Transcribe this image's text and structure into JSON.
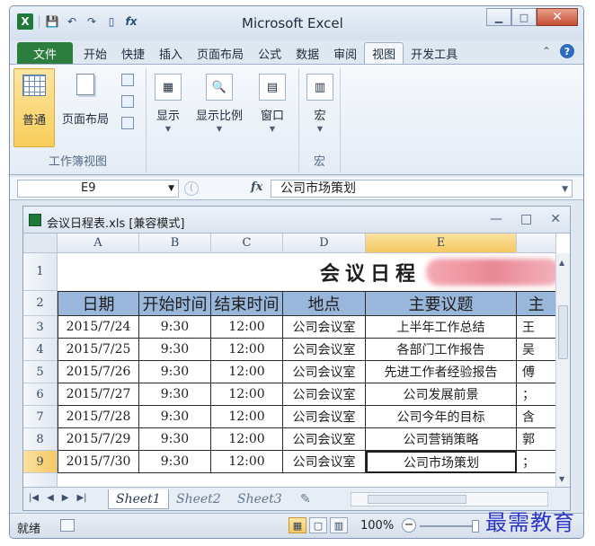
{
  "window": {
    "title": "Microsoft Excel",
    "minimize": "▁",
    "maximize": "□",
    "close": "✕"
  },
  "qat": {
    "logo": "X",
    "save": "💾",
    "undo": "↶",
    "redo": "↷",
    "new": "▯",
    "fx": "fx"
  },
  "tabs": {
    "file": "文件",
    "items": [
      "开始",
      "快捷",
      "插入",
      "页面布局",
      "公式",
      "数据",
      "审阅",
      "视图",
      "开发工具"
    ],
    "active_index": 7,
    "collapse": "⌃",
    "help": "?"
  },
  "ribbon": {
    "normal": "普通",
    "page_layout": "页面布局",
    "group_views": "工作簿视图",
    "show": "显示",
    "zoom": "显示比例",
    "window": "窗口",
    "macro": "宏",
    "group_macro": "宏"
  },
  "formula_bar": {
    "name_box": "E9",
    "fx": "fx",
    "content": "公司市场策划"
  },
  "workbook": {
    "name": "会议日程表.xls  [兼容模式]",
    "minimize": "—",
    "restore": "□",
    "close": "✕"
  },
  "sheet": {
    "columns": [
      "A",
      "B",
      "C",
      "D",
      "E"
    ],
    "selected_column": "E",
    "rows": [
      "1",
      "2",
      "3",
      "4",
      "5",
      "6",
      "7",
      "8",
      "9"
    ],
    "selected_row": "9",
    "title": "会议日程",
    "headers": [
      "日期",
      "开始时间",
      "结束时间",
      "地点",
      "主要议题",
      "主"
    ],
    "data": [
      [
        "2015/7/24",
        "9:30",
        "12:00",
        "公司会议室",
        "上半年工作总结",
        "王"
      ],
      [
        "2015/7/25",
        "9:30",
        "12:00",
        "公司会议室",
        "各部门工作报告",
        "吴"
      ],
      [
        "2015/7/26",
        "9:30",
        "12:00",
        "公司会议室",
        "先进工作者经验报告",
        "傅"
      ],
      [
        "2015/7/27",
        "9:30",
        "12:00",
        "公司会议室",
        "公司发展前景",
        "；"
      ],
      [
        "2015/7/28",
        "9:30",
        "12:00",
        "公司会议室",
        "公司今年的目标",
        "含"
      ],
      [
        "2015/7/29",
        "9:30",
        "12:00",
        "公司会议室",
        "公司营销策略",
        "郭"
      ],
      [
        "2015/7/30",
        "9:30",
        "12:00",
        "公司会议室",
        "公司市场策划",
        "；"
      ]
    ]
  },
  "sheet_tabs": [
    "Sheet1",
    "Sheet2",
    "Sheet3"
  ],
  "status": {
    "ready": "就绪",
    "zoom": "100%",
    "zoom_minus": "−"
  },
  "watermark": "最需教育"
}
